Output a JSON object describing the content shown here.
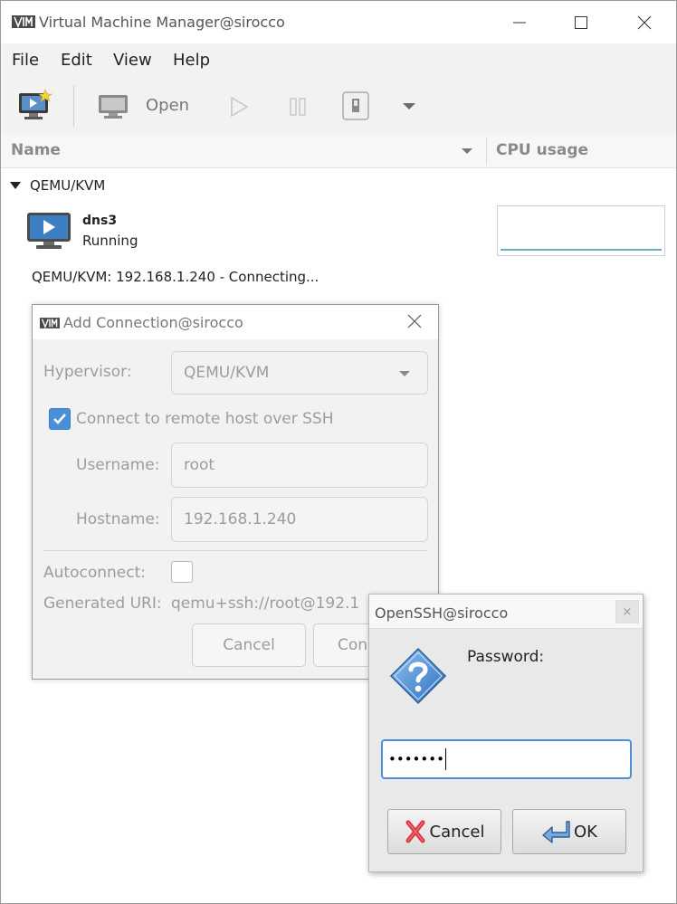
{
  "main_window": {
    "title": "Virtual Machine Manager@sirocco",
    "menu": [
      "File",
      "Edit",
      "View",
      "Help"
    ],
    "toolbar": {
      "open_label": "Open"
    },
    "columns": {
      "name": "Name",
      "cpu": "CPU usage"
    },
    "connection_group": "QEMU/KVM",
    "vms": [
      {
        "name": "dns3",
        "status": "Running"
      }
    ],
    "connecting_row": "QEMU/KVM: 192.168.1.240 - Connecting..."
  },
  "add_connection": {
    "title": "Add Connection@sirocco",
    "hypervisor_label": "Hypervisor:",
    "hypervisor_value": "QEMU/KVM",
    "ssh_checkbox_label": "Connect to remote host over SSH",
    "ssh_checked": true,
    "username_label": "Username:",
    "username_value": "root",
    "hostname_label": "Hostname:",
    "hostname_value": "192.168.1.240",
    "autoconnect_label": "Autoconnect:",
    "autoconnect_checked": false,
    "generated_uri_label": "Generated URI:",
    "generated_uri_value": "qemu+ssh://root@192.1",
    "cancel_label": "Cancel",
    "connect_label": "Con"
  },
  "openssh": {
    "title": "OpenSSH@sirocco",
    "close_glyph": "×",
    "password_label": "Password:",
    "password_value": "•••••••",
    "cancel_label": "Cancel",
    "ok_label": "OK"
  },
  "colors": {
    "accent": "#4a90d9",
    "cpu_line": "#6aaec4",
    "cancel_icon": "#d9333f"
  }
}
